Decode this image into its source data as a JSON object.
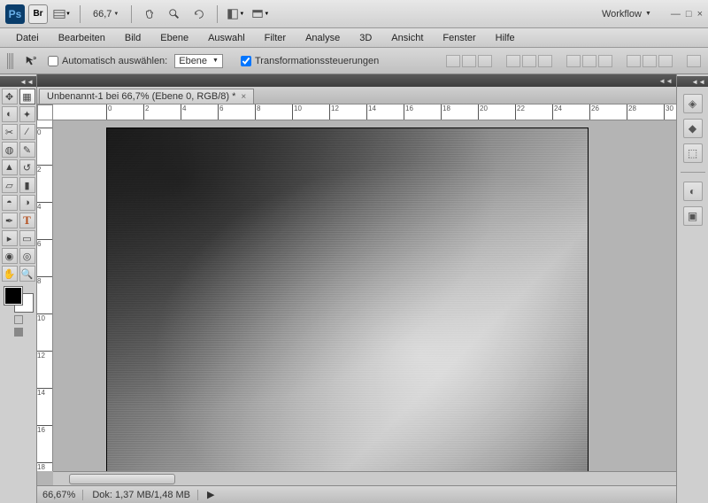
{
  "topbar": {
    "zoom": "66,7",
    "workflow_label": "Workflow"
  },
  "menu": [
    "Datei",
    "Bearbeiten",
    "Bild",
    "Ebene",
    "Auswahl",
    "Filter",
    "Analyse",
    "3D",
    "Ansicht",
    "Fenster",
    "Hilfe"
  ],
  "options": {
    "auto_select_label": "Automatisch auswählen:",
    "auto_select_value": "Ebene",
    "transform_label": "Transformationssteuerungen"
  },
  "document": {
    "tab_title": "Unbenannt-1 bei 66,7% (Ebene 0, RGB/8) *"
  },
  "ruler_h": [
    "0",
    "2",
    "4",
    "6",
    "8",
    "10",
    "12",
    "14",
    "16",
    "18",
    "20",
    "22",
    "24",
    "26",
    "28",
    "30"
  ],
  "ruler_v": [
    "0",
    "2",
    "4",
    "6",
    "8",
    "10",
    "12",
    "14",
    "16",
    "18"
  ],
  "status": {
    "zoom": "66,67%",
    "doc_label": "Dok:",
    "doc_size": "1,37 MB/1,48 MB"
  },
  "colors": {
    "fg": "#000000",
    "bg": "#ffffff"
  }
}
